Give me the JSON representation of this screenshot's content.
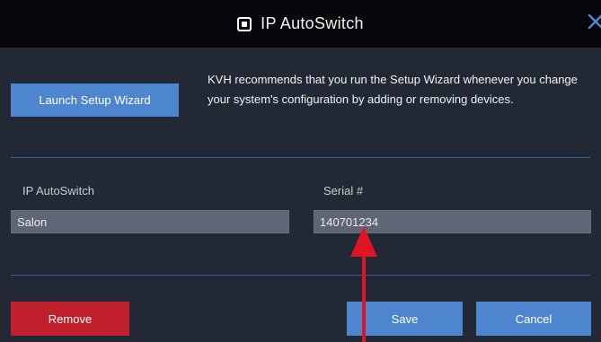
{
  "window": {
    "title": "IP AutoSwitch",
    "title_icon": "window-icon",
    "close_icon": "close-icon"
  },
  "setup": {
    "launch_label": "Launch Setup Wizard",
    "recommendation": "KVH recommends that you run the Setup Wizard whenever you change your system's configuration by adding or removing devices."
  },
  "fields": {
    "ipswitch_label": "IP AutoSwitch",
    "ipswitch_value": "Salon",
    "serial_label": "Serial #",
    "serial_value": "140701234"
  },
  "actions": {
    "remove_label": "Remove",
    "save_label": "Save",
    "cancel_label": "Cancel"
  },
  "colors": {
    "background": "#222834",
    "titlebar": "#05070b",
    "accent_blue": "#4d86ce",
    "danger_red": "#c0202b",
    "input_bg": "#5f6575",
    "annotation_arrow": "#e01423"
  }
}
